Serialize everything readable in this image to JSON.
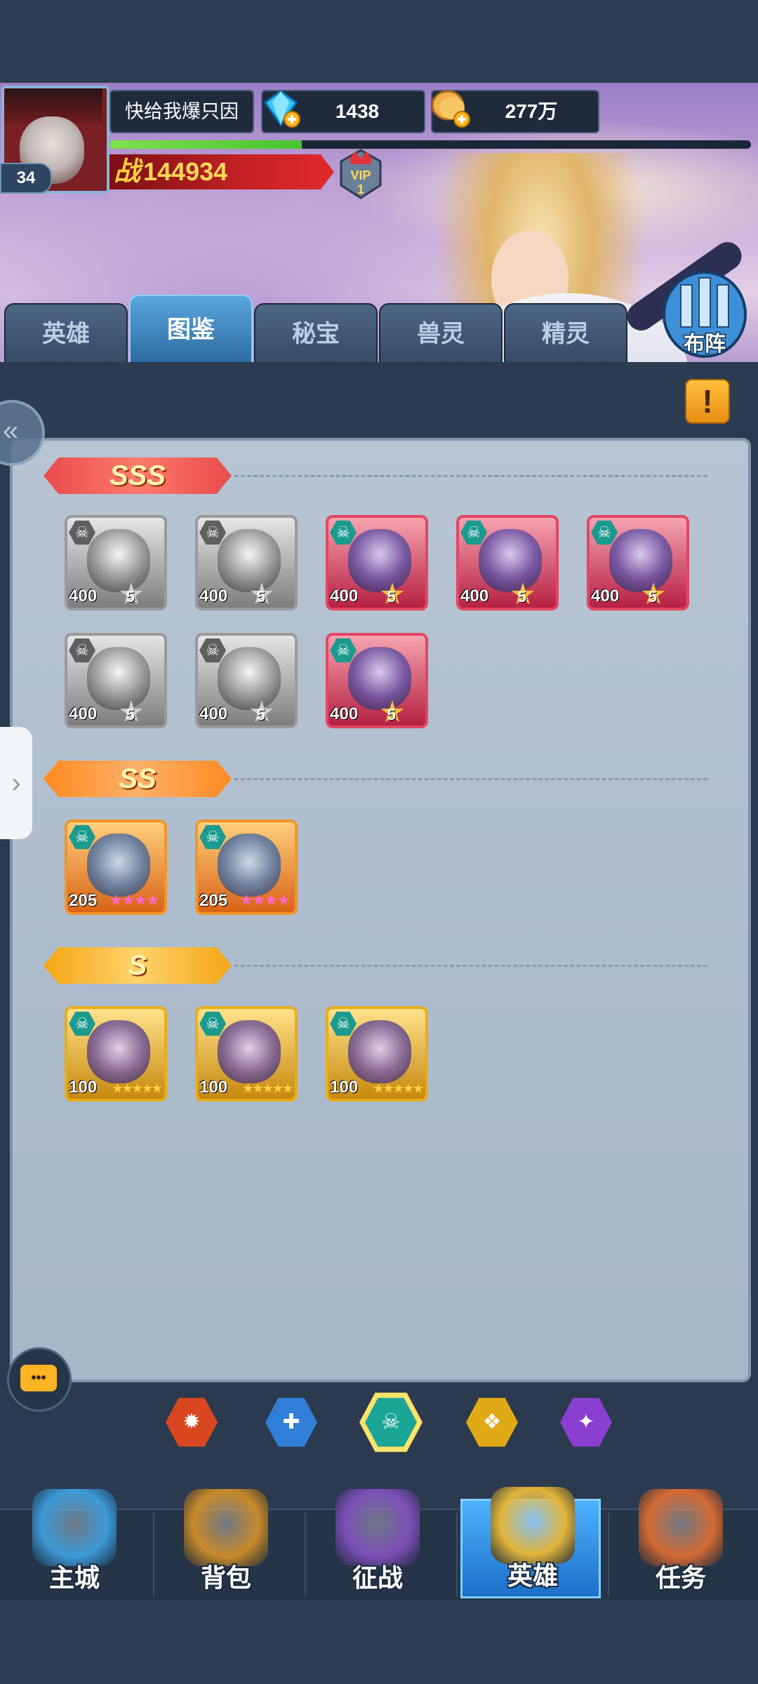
{
  "player": {
    "name": "快给我爆只因",
    "level": "34",
    "power_prefix": "战",
    "power": "144934",
    "vip": "VIP",
    "vip_level": "1",
    "exp_fraction": 0.3
  },
  "resources": {
    "diamonds": "1438",
    "gold": "277万"
  },
  "tabs": [
    {
      "label": "英雄"
    },
    {
      "label": "图鉴",
      "active": true
    },
    {
      "label": "秘宝"
    },
    {
      "label": "兽灵"
    },
    {
      "label": "精灵"
    }
  ],
  "formation_label": "布阵",
  "info_icon": "!",
  "tiers": {
    "sss": "SSS",
    "ss": "SS",
    "s": "S"
  },
  "sss_heroes": [
    {
      "level": "400",
      "stars": "5",
      "owned": false
    },
    {
      "level": "400",
      "stars": "5",
      "owned": false
    },
    {
      "level": "400",
      "stars": "5",
      "owned": true
    },
    {
      "level": "400",
      "stars": "5",
      "owned": true
    },
    {
      "level": "400",
      "stars": "5",
      "owned": true
    },
    {
      "level": "400",
      "stars": "5",
      "owned": false
    },
    {
      "level": "400",
      "stars": "5",
      "owned": false
    },
    {
      "level": "400",
      "stars": "5",
      "owned": true
    }
  ],
  "ss_heroes": [
    {
      "level": "205",
      "stars": 4
    },
    {
      "level": "205",
      "stars": 4
    }
  ],
  "s_heroes": [
    {
      "level": "100",
      "stars": 5
    },
    {
      "level": "100",
      "stars": 5
    },
    {
      "level": "100",
      "stars": 5
    }
  ],
  "faction_filters": [
    {
      "icon": "fire-faction-icon",
      "color": "#d8471f"
    },
    {
      "icon": "light-faction-icon",
      "color": "#2f7fd8"
    },
    {
      "icon": "skull-faction-icon",
      "color": "#1aa596",
      "active": true
    },
    {
      "icon": "wind-faction-icon",
      "color": "#e0a916"
    },
    {
      "icon": "dark-faction-icon",
      "color": "#8b3fd0"
    }
  ],
  "nav": [
    {
      "label": "主城",
      "icon": "castle-icon"
    },
    {
      "label": "背包",
      "icon": "chest-icon"
    },
    {
      "label": "征战",
      "icon": "portal-icon"
    },
    {
      "label": "英雄",
      "icon": "helmet-icon",
      "active": true
    },
    {
      "label": "任务",
      "icon": "scroll-icon"
    }
  ]
}
